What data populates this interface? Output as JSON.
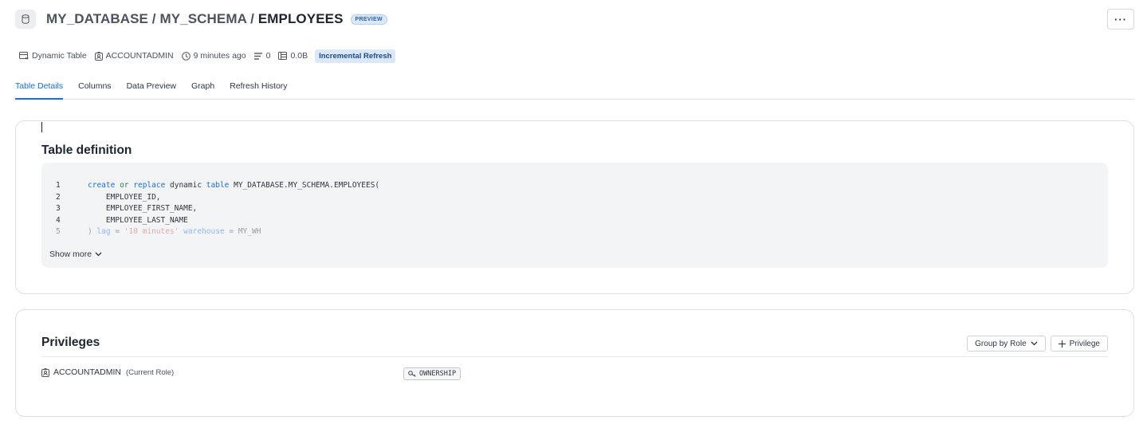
{
  "header": {
    "title_path": "MY_DATABASE / MY_SCHEMA / ",
    "table_name": "EMPLOYEES",
    "badge": "PREVIEW",
    "more_label": "···"
  },
  "meta": {
    "type": "Dynamic Table",
    "owner": "ACCOUNTADMIN",
    "updated": "9 minutes ago",
    "rows": "0",
    "size": "0.0B",
    "refresh_mode": "Incremental Refresh"
  },
  "tabs": [
    {
      "label": "Table Details",
      "active": true
    },
    {
      "label": "Columns"
    },
    {
      "label": "Data Preview"
    },
    {
      "label": "Graph"
    },
    {
      "label": "Refresh History"
    }
  ],
  "definition": {
    "title": "Table definition",
    "lines": [
      {
        "n": "1",
        "parts": [
          [
            "kw",
            "create"
          ],
          [
            "",
            " "
          ],
          [
            "kw2",
            "or"
          ],
          [
            "",
            " "
          ],
          [
            "kw",
            "replace"
          ],
          [
            "",
            " dynamic "
          ],
          [
            "kw",
            "table"
          ],
          [
            "",
            " MY_DATABASE.MY_SCHEMA.EMPLOYEES("
          ]
        ]
      },
      {
        "n": "2",
        "parts": [
          [
            "",
            "    EMPLOYEE_ID,"
          ]
        ]
      },
      {
        "n": "3",
        "parts": [
          [
            "",
            "    EMPLOYEE_FIRST_NAME,"
          ]
        ]
      },
      {
        "n": "4",
        "parts": [
          [
            "",
            "    EMPLOYEE_LAST_NAME"
          ]
        ]
      },
      {
        "n": "5",
        "parts": [
          [
            "",
            ") "
          ],
          [
            "kw",
            "lag"
          ],
          [
            "",
            " = "
          ],
          [
            "str",
            "'10 minutes'"
          ],
          [
            "",
            ""
          ],
          [
            "",
            " "
          ],
          [
            "kw",
            "warehouse"
          ],
          [
            "",
            " = MY_WH"
          ]
        ]
      }
    ],
    "show_more": "Show more"
  },
  "privileges": {
    "title": "Privileges",
    "group_by": "Group by Role",
    "add_privilege": "Privilege",
    "role": "ACCOUNTADMIN",
    "role_note": "(Current Role)",
    "privilege": "OWNERSHIP"
  },
  "colors": {
    "accent": "#1a6ee0",
    "badge_bg": "#dbe8fa"
  }
}
